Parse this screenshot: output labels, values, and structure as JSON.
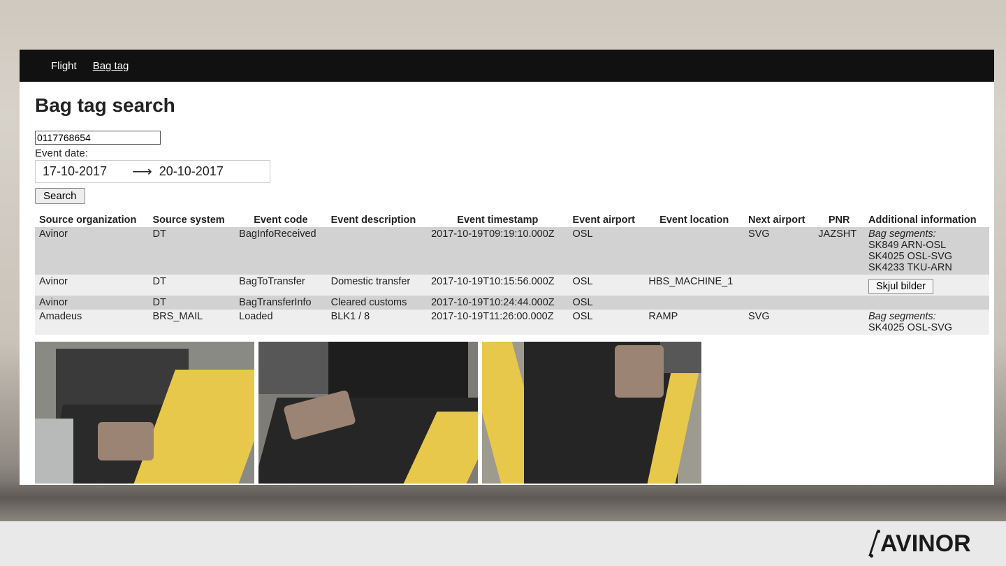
{
  "nav": {
    "items": [
      "Flight",
      "Bag tag"
    ],
    "active": "Bag tag"
  },
  "page": {
    "title": "Bag tag search"
  },
  "search": {
    "tag_value": "0117768654",
    "event_date_label": "Event date:",
    "date_from": "17-10-2017",
    "date_arrow": "⟶",
    "date_to": "20-10-2017",
    "button_label": "Search"
  },
  "table": {
    "headers": [
      "Source organization",
      "Source system",
      "Event code",
      "Event description",
      "Event timestamp",
      "Event airport",
      "Event location",
      "Next airport",
      "PNR",
      "Additional information"
    ],
    "rows": [
      {
        "org": "Avinor",
        "system": "DT",
        "code": "BagInfoReceived",
        "desc": "",
        "timestamp": "2017-10-19T09:19:10.000Z",
        "airport": "OSL",
        "location": "",
        "next": "SVG",
        "pnr": "JAZSHT",
        "info_title": "Bag segments:",
        "info_lines": [
          "SK849 ARN-OSL",
          "SK4025 OSL-SVG",
          "SK4233 TKU-ARN"
        ]
      },
      {
        "org": "Avinor",
        "system": "DT",
        "code": "BagToTransfer",
        "desc": "Domestic transfer",
        "timestamp": "2017-10-19T10:15:56.000Z",
        "airport": "OSL",
        "location": "HBS_MACHINE_1",
        "next": "",
        "pnr": "",
        "button_label": "Skjul bilder"
      },
      {
        "org": "Avinor",
        "system": "DT",
        "code": "BagTransferInfo",
        "desc": "Cleared customs",
        "timestamp": "2017-10-19T10:24:44.000Z",
        "airport": "OSL",
        "location": "",
        "next": "",
        "pnr": ""
      },
      {
        "org": "Amadeus",
        "system": "BRS_MAIL",
        "code": "Loaded",
        "desc": "BLK1 / 8",
        "timestamp": "2017-10-19T11:26:00.000Z",
        "airport": "OSL",
        "location": "RAMP",
        "next": "SVG",
        "pnr": "",
        "info_title": "Bag segments:",
        "info_lines": [
          "SK4025 OSL-SVG"
        ]
      }
    ]
  },
  "footer": {
    "logo_text": "AVINOR"
  }
}
